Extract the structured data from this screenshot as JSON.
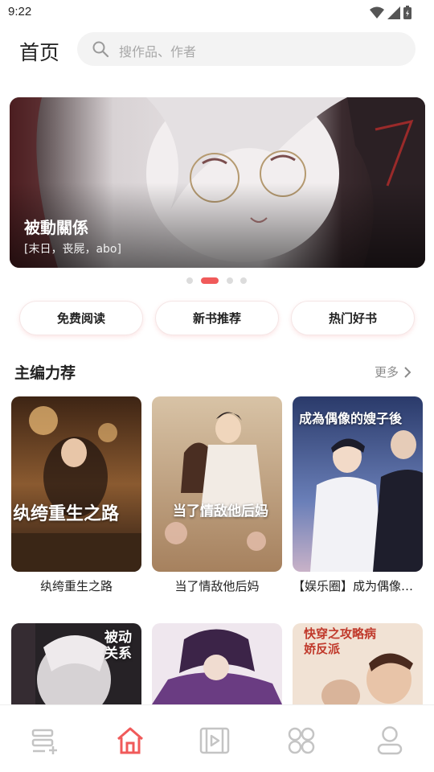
{
  "status_bar": {
    "time": "9:22"
  },
  "header": {
    "title": "首页",
    "search_placeholder": "搜作品、作者"
  },
  "banner": {
    "title": "被動關係",
    "tags": "[末日，丧屍，abo]",
    "dot_count": 4,
    "active_dot": 1
  },
  "quick_buttons": [
    "免费阅读",
    "新书推荐",
    "热门好书"
  ],
  "section": {
    "title": "主编力荐",
    "more": "更多"
  },
  "books": [
    {
      "title": "纨绔重生之路",
      "cover_text": "纨绔重生之路"
    },
    {
      "title": "当了情敌他后妈",
      "cover_text": "当了情敌他后妈"
    },
    {
      "title": "【娱乐圈】成为偶像的嫂子后",
      "cover_text": "成為偶像的嫂子後"
    },
    {
      "title": "",
      "cover_text": "被动关系"
    },
    {
      "title": "",
      "cover_text": ""
    },
    {
      "title": "",
      "cover_text": "快穿之攻略病娇反派"
    }
  ],
  "bottom_nav": [
    {
      "name": "bookshelf",
      "icon": "bookshelf-add-icon",
      "active": false
    },
    {
      "name": "home",
      "icon": "home-icon",
      "active": true
    },
    {
      "name": "video",
      "icon": "film-icon",
      "active": false
    },
    {
      "name": "category",
      "icon": "grid-icon",
      "active": false
    },
    {
      "name": "profile",
      "icon": "user-icon",
      "active": false
    }
  ],
  "colors": {
    "accent": "#f05a5a",
    "inactive_icon": "#c4c4c4"
  }
}
